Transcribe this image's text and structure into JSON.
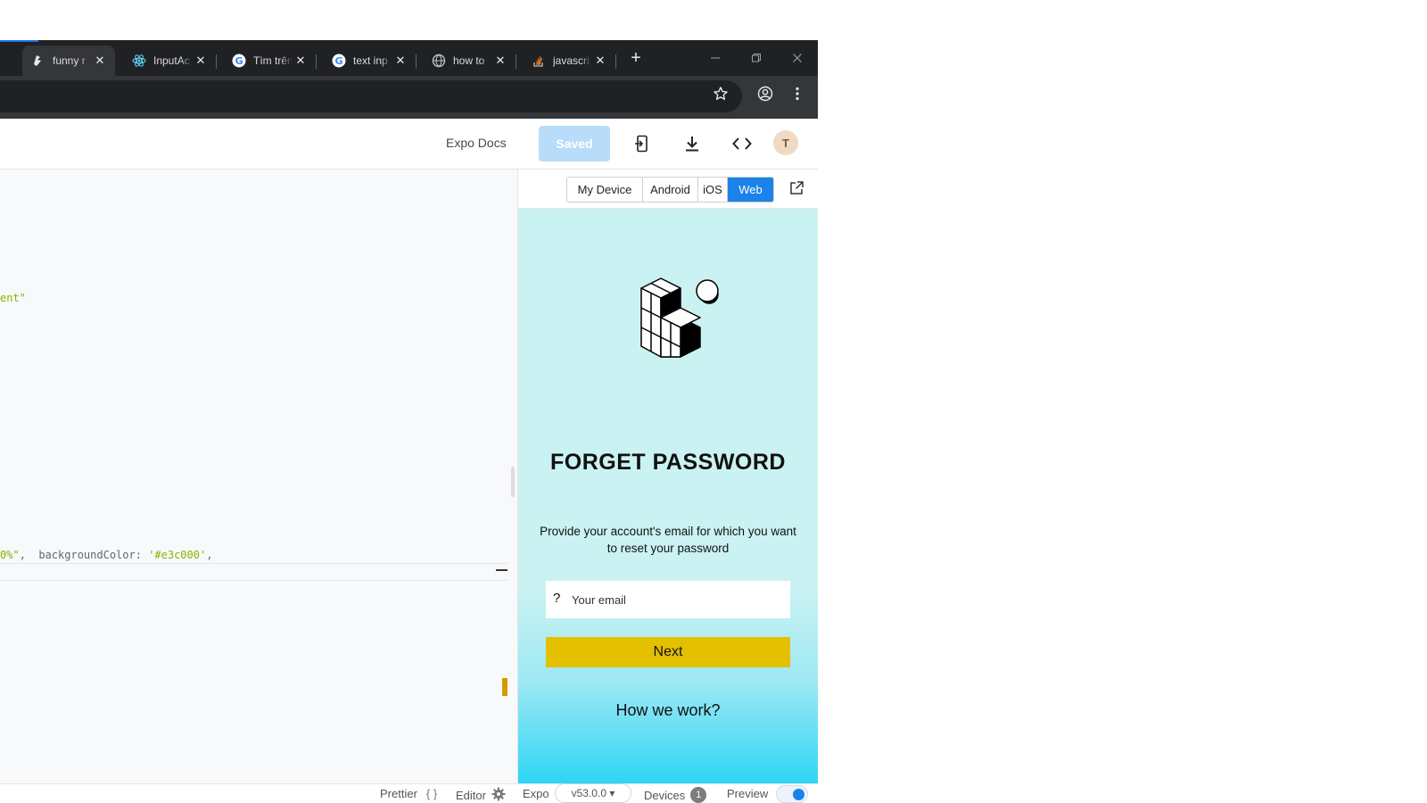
{
  "browser": {
    "tabs": [
      {
        "label": "funny r",
        "icon": "snack-icon",
        "active": true
      },
      {
        "label": "InputAc",
        "icon": "react-icon",
        "active": false
      },
      {
        "label": "Tìm trên",
        "icon": "google-icon",
        "active": false
      },
      {
        "label": "text inp",
        "icon": "google-icon",
        "active": false
      },
      {
        "label": "how to",
        "icon": "globe-icon",
        "active": false
      },
      {
        "label": "javascri",
        "icon": "stackoverflow-icon",
        "active": false
      }
    ],
    "new_tab": "+",
    "close_glyph": "✕"
  },
  "header": {
    "docs_label": "Expo Docs",
    "saved_label": "Saved",
    "avatar_initial": "T"
  },
  "editor": {
    "line1_str": "ent\"",
    "line2_pre": "0%\"",
    "line2_mid": ",  backgroundColor: ",
    "line2_str": "'#e3c000'",
    "line2_post": ","
  },
  "preview": {
    "device_tabs": [
      "My Device",
      "Android",
      "iOS",
      "Web"
    ],
    "active_device": "Web",
    "app": {
      "title": "FORGET PASSWORD",
      "description": "Provide your account's email for which you want to reset your password",
      "email_icon": "?",
      "email_placeholder": "Your email",
      "next_label": "Next",
      "how_label": "How we work?"
    }
  },
  "footer": {
    "prettier_label": "Prettier",
    "prettier_icon": "{ }",
    "editor_label": "Editor",
    "expo_label": "Expo",
    "sdk_version": "v53.0.0 ▾",
    "devices_label": "Devices",
    "devices_count": "1",
    "preview_label": "Preview"
  },
  "colors": {
    "accent": "#1a82e8",
    "saved_button": "#b9dcfa",
    "next_button": "#e3c000",
    "preview_bg_top": "#cbf2f2",
    "preview_bg_bottom": "#2fd5f5"
  }
}
